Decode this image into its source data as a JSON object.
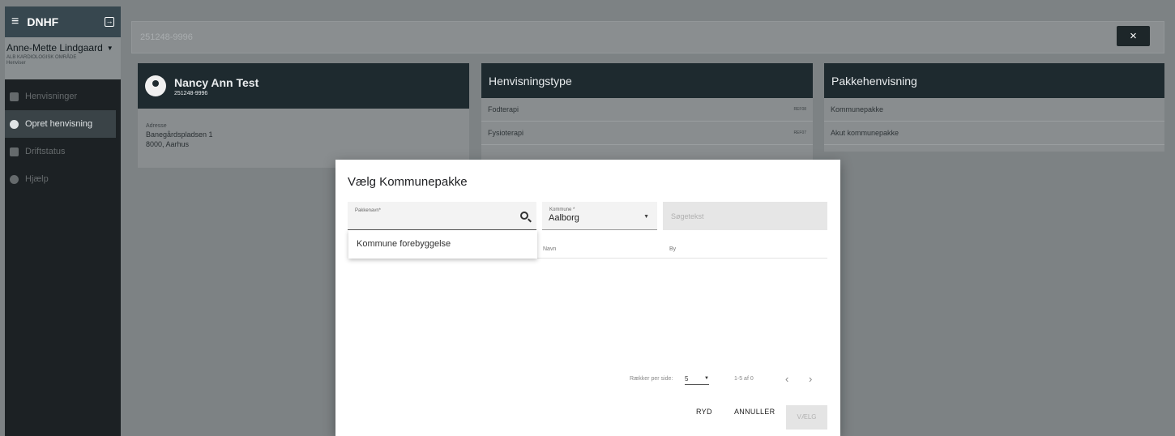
{
  "sidebar": {
    "brand": "DNHF",
    "user_name": "Anne-Mette Lindgaard",
    "user_department": "ALB KARDIOLOGISK OMRÅDE",
    "user_role": "Henviser",
    "items": [
      {
        "label": "Henvisninger",
        "icon": "folder-icon"
      },
      {
        "label": "Opret henvisning",
        "icon": "add-person-icon"
      },
      {
        "label": "Driftstatus",
        "icon": "calendar-icon"
      },
      {
        "label": "Hjælp",
        "icon": "help-icon"
      }
    ]
  },
  "search": {
    "value": "251248-9996",
    "close_label": "×"
  },
  "patient": {
    "name": "Nancy Ann Test",
    "cpr": "251248-9996",
    "address_label": "Adresse",
    "address_line1": "Banegårdspladsen 1",
    "address_line2": "8000, Aarhus"
  },
  "henvisningstype": {
    "title": "Henvisningstype",
    "rows": [
      {
        "label": "Fodterapi",
        "code": "REF08"
      },
      {
        "label": "Fysioterapi",
        "code": "REF07"
      }
    ]
  },
  "pakkehenvisning": {
    "title": "Pakkehenvisning",
    "rows": [
      {
        "label": "Kommunepakke"
      },
      {
        "label": "Akut kommunepakke"
      }
    ]
  },
  "dialog": {
    "title": "Vælg Kommunepakke",
    "pakkenavn_label": "Pakkenavn*",
    "kommune_label": "Kommune *",
    "kommune_value": "Aalborg",
    "sogetekst_placeholder": "Søgetekst",
    "dropdown_option": "Kommune forebyggelse",
    "col_navn": "Navn",
    "col_by": "By",
    "rows_per_page_label": "Rækker per side:",
    "rows_per_page_value": "5",
    "range": "1-5 af 0",
    "prev": "‹",
    "next": "›",
    "btn_ryd": "RYD",
    "btn_annuller": "ANNULLER",
    "btn_vaelg": "VÆLG"
  }
}
